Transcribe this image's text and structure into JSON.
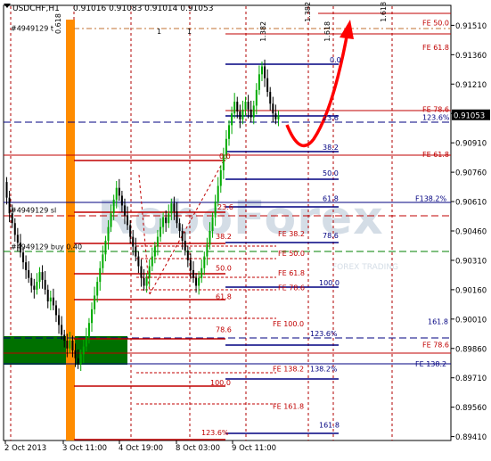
{
  "header": {
    "symbol": "USDCHF,H1",
    "ohlc": "0.91016 0.91083 0.91014 0.91053"
  },
  "chart_data": {
    "type": "candlestick",
    "symbol": "USDCHF,H1",
    "ylim": [
      0.8941,
      0.9156
    ],
    "x_ticks": [
      "2 Oct 2013",
      "3 Oct 11:00",
      "4 Oct 19:00",
      "8 Oct 03:00",
      "9 Oct 11:00"
    ],
    "y_ticks": [
      "0.91510",
      "0.91360",
      "0.91210",
      "0.91060",
      "0.90910",
      "0.90760",
      "0.90610",
      "0.90460",
      "0.90310",
      "0.90160",
      "0.90010",
      "0.89860",
      "0.89710",
      "0.89560",
      "0.89410"
    ],
    "current_price": "0.91053",
    "price_line_color": "#808080",
    "candle_colors": {
      "bull": "#00aa00",
      "bear": "#000000"
    },
    "price_path": [
      [
        0.9071,
        0.9063
      ],
      [
        0.9063,
        0.9055
      ],
      [
        0.9055,
        0.905
      ],
      [
        0.905,
        0.9044
      ],
      [
        0.9044,
        0.904
      ],
      [
        0.904,
        0.9035
      ],
      [
        0.9035,
        0.903
      ],
      [
        0.903,
        0.9026
      ],
      [
        0.9026,
        0.9022
      ],
      [
        0.9022,
        0.9018
      ],
      [
        0.9018,
        0.9016
      ],
      [
        0.9016,
        0.902
      ],
      [
        0.902,
        0.9025
      ],
      [
        0.9025,
        0.9021
      ],
      [
        0.9021,
        0.9016
      ],
      [
        0.9016,
        0.901
      ],
      [
        0.901,
        0.9012
      ],
      [
        0.9012,
        0.9008
      ],
      [
        0.9008,
        0.9003
      ],
      [
        0.9003,
        0.8998
      ],
      [
        0.8998,
        0.8993
      ],
      [
        0.8993,
        0.899
      ],
      [
        0.899,
        0.8986
      ],
      [
        0.8986,
        0.899
      ],
      [
        0.899,
        0.8985
      ],
      [
        0.8985,
        0.8981
      ],
      [
        0.8981,
        0.8978
      ],
      [
        0.8978,
        0.8983
      ],
      [
        0.8983,
        0.8987
      ],
      [
        0.8987,
        0.8992
      ],
      [
        0.8992,
        0.8999
      ],
      [
        0.8999,
        0.9006
      ],
      [
        0.9006,
        0.9013
      ],
      [
        0.9013,
        0.902
      ],
      [
        0.902,
        0.9027
      ],
      [
        0.9027,
        0.9034
      ],
      [
        0.9034,
        0.9041
      ],
      [
        0.9041,
        0.9048
      ],
      [
        0.9048,
        0.9055
      ],
      [
        0.9055,
        0.9062
      ],
      [
        0.9062,
        0.9068
      ],
      [
        0.9068,
        0.9064
      ],
      [
        0.9064,
        0.9059
      ],
      [
        0.9059,
        0.9054
      ],
      [
        0.9054,
        0.9049
      ],
      [
        0.9049,
        0.9043
      ],
      [
        0.9043,
        0.9038
      ],
      [
        0.9038,
        0.9033
      ],
      [
        0.9033,
        0.9028
      ],
      [
        0.9028,
        0.9022
      ],
      [
        0.9022,
        0.9018
      ],
      [
        0.9018,
        0.9022
      ],
      [
        0.9022,
        0.9028
      ],
      [
        0.9028,
        0.9033
      ],
      [
        0.9033,
        0.9038
      ],
      [
        0.9038,
        0.9043
      ],
      [
        0.9043,
        0.9048
      ],
      [
        0.9048,
        0.9053
      ],
      [
        0.9053,
        0.905
      ],
      [
        0.905,
        0.9055
      ],
      [
        0.9055,
        0.906
      ],
      [
        0.906,
        0.9056
      ],
      [
        0.9056,
        0.905
      ],
      [
        0.905,
        0.9046
      ],
      [
        0.9046,
        0.9041
      ],
      [
        0.9041,
        0.9036
      ],
      [
        0.9036,
        0.9031
      ],
      [
        0.9031,
        0.9026
      ],
      [
        0.9026,
        0.9022
      ],
      [
        0.9022,
        0.9018
      ],
      [
        0.9018,
        0.9022
      ],
      [
        0.9022,
        0.9027
      ],
      [
        0.9027,
        0.9033
      ],
      [
        0.9033,
        0.9039
      ],
      [
        0.9039,
        0.9046
      ],
      [
        0.9046,
        0.9053
      ],
      [
        0.9053,
        0.9061
      ],
      [
        0.9061,
        0.9069
      ],
      [
        0.9069,
        0.9077
      ],
      [
        0.9077,
        0.9085
      ],
      [
        0.9085,
        0.9093
      ],
      [
        0.9093,
        0.91
      ],
      [
        0.91,
        0.9106
      ],
      [
        0.9106,
        0.9112
      ],
      [
        0.9112,
        0.9107
      ],
      [
        0.9107,
        0.9103
      ],
      [
        0.9103,
        0.9108
      ],
      [
        0.9108,
        0.9112
      ],
      [
        0.9112,
        0.9108
      ],
      [
        0.9108,
        0.9104
      ],
      [
        0.9104,
        0.911
      ],
      [
        0.911,
        0.9118
      ],
      [
        0.9118,
        0.9126
      ],
      [
        0.9126,
        0.913
      ],
      [
        0.913,
        0.9124
      ],
      [
        0.9124,
        0.9117
      ],
      [
        0.9117,
        0.9111
      ],
      [
        0.9111,
        0.9106
      ],
      [
        0.9106,
        0.9103
      ],
      [
        0.9103,
        0.9105
      ]
    ],
    "labels": [
      {
        "text": "#4949129 t",
        "price": 0.91497,
        "x": 12,
        "color": "#000000"
      },
      {
        "text": "#4949129 sl",
        "price": 0.90567,
        "x": 12,
        "color": "#000000"
      },
      {
        "text": "#4949129 buy 0.40",
        "price": 0.90381,
        "x": 12,
        "color": "#000000"
      },
      {
        "text": "0.618",
        "price": 0.9148,
        "x": 68,
        "color": "#000000",
        "rotate": true
      },
      {
        "text": "1.382",
        "price": 0.9144,
        "x": 298,
        "color": "#000000",
        "rotate": true
      },
      {
        "text": "1.382",
        "price": 0.9154,
        "x": 348,
        "color": "#000000",
        "rotate": true
      },
      {
        "text": "1.618",
        "price": 0.9144,
        "x": 370,
        "color": "#000000",
        "rotate": true
      },
      {
        "text": "1.618",
        "price": 0.9154,
        "x": 433,
        "color": "#000000",
        "rotate": true
      },
      {
        "text": "1",
        "price": 0.9148,
        "x": 176,
        "color": "#000000"
      },
      {
        "text": "1",
        "price": 0.9148,
        "x": 210,
        "color": "#000000"
      },
      {
        "text": "0.0",
        "price": 0.91335,
        "x": 370,
        "color": "#000080"
      },
      {
        "text": "23.6",
        "price": 0.91038,
        "x": 362,
        "color": "#000080"
      },
      {
        "text": "38.2",
        "price": 0.90887,
        "x": 362,
        "color": "#000080"
      },
      {
        "text": "50.0",
        "price": 0.90757,
        "x": 362,
        "color": "#000080"
      },
      {
        "text": "61.8",
        "price": 0.90627,
        "x": 362,
        "color": "#000080"
      },
      {
        "text": "78.6",
        "price": 0.90437,
        "x": 362,
        "color": "#000080"
      },
      {
        "text": "100.0",
        "price": 0.90196,
        "x": 358,
        "color": "#000080"
      },
      {
        "text": "123.6%",
        "price": 0.89936,
        "x": 348,
        "color": "#000080"
      },
      {
        "text": "138.2%",
        "price": 0.89756,
        "x": 348,
        "color": "#000080"
      },
      {
        "text": "161.8",
        "price": 0.8947,
        "x": 358,
        "color": "#000080"
      },
      {
        "text": "0.0",
        "price": 0.90842,
        "x": 246,
        "color": "#c00000"
      },
      {
        "text": "23.6",
        "price": 0.90582,
        "x": 244,
        "color": "#c00000"
      },
      {
        "text": "38.2",
        "price": 0.90432,
        "x": 242,
        "color": "#c00000"
      },
      {
        "text": "50.0",
        "price": 0.90271,
        "x": 242,
        "color": "#c00000"
      },
      {
        "text": "61.8",
        "price": 0.90126,
        "x": 242,
        "color": "#c00000"
      },
      {
        "text": "78.6",
        "price": 0.89956,
        "x": 242,
        "color": "#c00000"
      },
      {
        "text": "100.0",
        "price": 0.89686,
        "x": 236,
        "color": "#c00000"
      },
      {
        "text": "123.6%",
        "price": 0.89431,
        "x": 226,
        "color": "#c00000"
      },
      {
        "text": "FE 38.2",
        "price": 0.90447,
        "x": 312,
        "color": "#c00000"
      },
      {
        "text": "FE 50.0",
        "price": 0.90346,
        "x": 312,
        "color": "#c00000"
      },
      {
        "text": "FE 61.8",
        "price": 0.90246,
        "x": 312,
        "color": "#c00000"
      },
      {
        "text": "FE 78.6",
        "price": 0.90172,
        "x": 312,
        "color": "#c00000"
      },
      {
        "text": "FE 100.0",
        "price": 0.89986,
        "x": 306,
        "color": "#c00000"
      },
      {
        "text": "FE 138.2",
        "price": 0.89756,
        "x": 306,
        "color": "#c00000"
      },
      {
        "text": "FE 161.8",
        "price": 0.89566,
        "x": 306,
        "color": "#c00000"
      },
      {
        "text": "FE 50.0",
        "price": 0.91523,
        "x": 474,
        "color": "#c00000"
      },
      {
        "text": "FE 61.8",
        "price": 0.91397,
        "x": 474,
        "color": "#c00000"
      },
      {
        "text": "FE 78.6",
        "price": 0.91082,
        "x": 474,
        "color": "#c00000"
      },
      {
        "text": "123.6%",
        "price": 0.9104,
        "x": 474,
        "color": "#000080"
      },
      {
        "text": "FE 61.8",
        "price": 0.90852,
        "x": 474,
        "color": "#c00000"
      },
      {
        "text": "F138.2%",
        "price": 0.90627,
        "x": 466,
        "color": "#000080"
      },
      {
        "text": "161.8",
        "price": 0.89998,
        "x": 480,
        "color": "#000080"
      },
      {
        "text": "FE 78.6",
        "price": 0.8988,
        "x": 474,
        "color": "#c00000"
      },
      {
        "text": "FE 138.2",
        "price": 0.89782,
        "x": 466,
        "color": "#000080"
      }
    ]
  }
}
